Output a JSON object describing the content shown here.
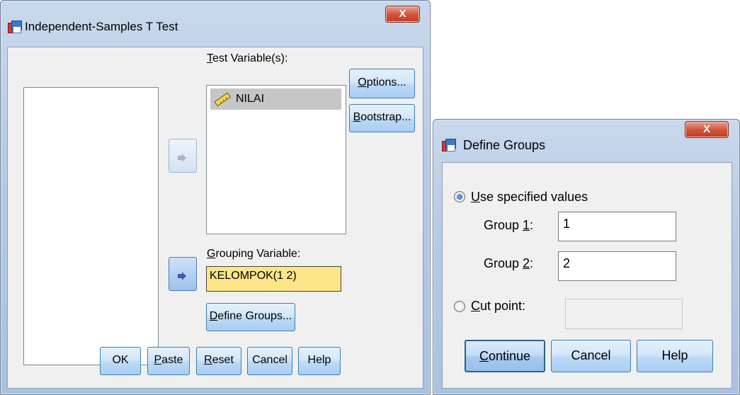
{
  "ttest": {
    "title": "Independent-Samples T Test",
    "close": "X",
    "test_variables": {
      "label_key": "T",
      "label_rest": "est Variable(s):",
      "items": [
        {
          "icon": "ruler-icon",
          "name": "NILAI"
        }
      ]
    },
    "grouping": {
      "label_key": "G",
      "label_rest": "rouping Variable:",
      "value": "KELOMPOK(1 2)"
    },
    "define_groups": {
      "key": "D",
      "rest": "efine Groups..."
    },
    "side_buttons": [
      {
        "key": "O",
        "rest": "ptions..."
      },
      {
        "key": "B",
        "rest": "ootstrap..."
      }
    ],
    "bottom_buttons": {
      "ok": "OK",
      "paste": {
        "key": "P",
        "rest": "aste"
      },
      "reset": {
        "key": "R",
        "rest": "eset"
      },
      "cancel": "Cancel",
      "help": "Help"
    }
  },
  "define_groups_dialog": {
    "title": "Define Groups",
    "close": "X",
    "use_specified": {
      "key": "U",
      "rest": "se specified values",
      "selected": true
    },
    "group1": {
      "label": "Group ",
      "key": "1",
      "suffix": ":",
      "value": "1"
    },
    "group2": {
      "label": "Group ",
      "key": "2",
      "suffix": ":",
      "value": "2"
    },
    "cut_point": {
      "key": "C",
      "rest": "ut point:",
      "selected": false,
      "value": ""
    },
    "buttons": {
      "continue": {
        "key": "C",
        "rest": "ontinue"
      },
      "cancel": "Cancel",
      "help": "Help"
    }
  }
}
